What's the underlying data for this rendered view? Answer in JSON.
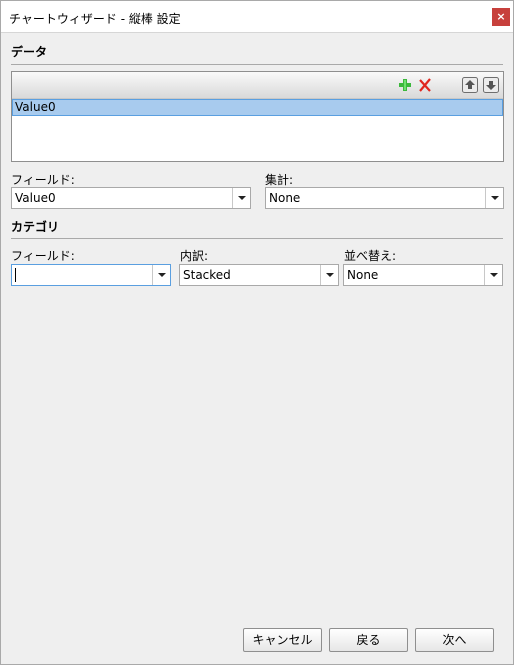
{
  "window": {
    "title": "チャートウィザード - 縦棒 設定",
    "close_label": "×"
  },
  "data_section": {
    "title": "データ",
    "toolbar": {
      "add_icon": "green-plus-icon",
      "delete_icon": "red-x-icon",
      "move_up_icon": "move-up-icon",
      "move_down_icon": "move-down-icon"
    },
    "items": [
      "Value0"
    ],
    "field_label": "フィールド:",
    "field_value": "Value0",
    "aggregate_label": "集計:",
    "aggregate_value": "None"
  },
  "category_section": {
    "title": "カテゴリ",
    "field_label": "フィールド:",
    "field_value": "",
    "breakdown_label": "内訳:",
    "breakdown_value": "Stacked",
    "sort_label": "並べ替え:",
    "sort_value": "None"
  },
  "footer": {
    "cancel_label": "キャンセル",
    "back_label": "戻る",
    "next_label": "次へ"
  },
  "colors": {
    "selection": "#a8cbee",
    "add_icon": "#3cb83c",
    "delete_icon": "#e0261e",
    "close_button": "#c7403c"
  }
}
